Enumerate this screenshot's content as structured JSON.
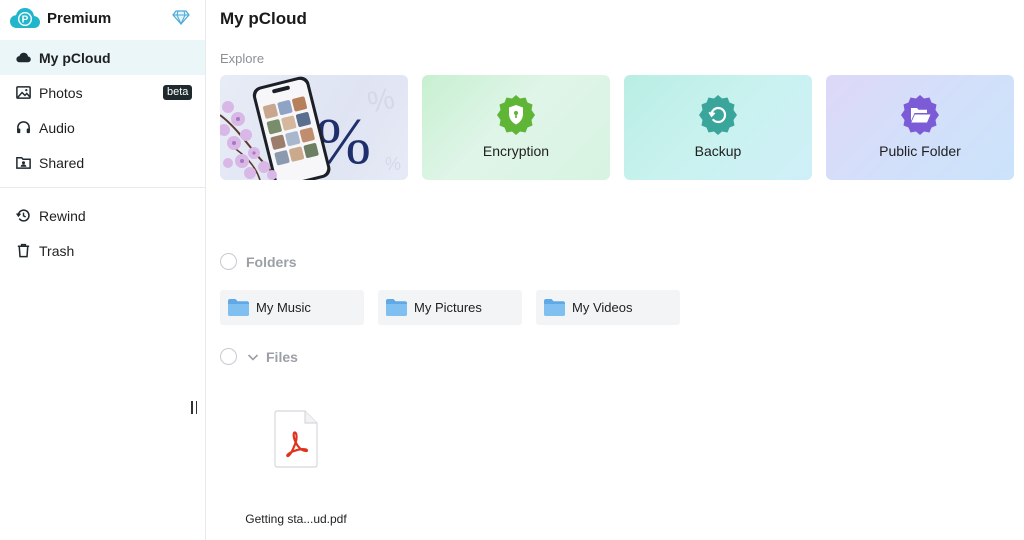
{
  "brand": {
    "name": "Premium",
    "logo_icon": "pcloud-logo-icon",
    "diamond_icon": "diamond-icon"
  },
  "sidebar": {
    "items": [
      {
        "label": "My pCloud",
        "icon": "cloud-icon",
        "active": true
      },
      {
        "label": "Photos",
        "icon": "image-icon",
        "badge": "beta"
      },
      {
        "label": "Audio",
        "icon": "headphones-icon"
      },
      {
        "label": "Shared",
        "icon": "shared-folder-icon"
      },
      {
        "label": "Rewind",
        "icon": "rewind-icon"
      },
      {
        "label": "Trash",
        "icon": "trash-icon"
      }
    ]
  },
  "main": {
    "title": "My pCloud",
    "explore_label": "Explore",
    "cards": [
      {
        "label": "",
        "kind": "promo",
        "promo_text": "%"
      },
      {
        "label": "Encryption",
        "icon": "shield-icon",
        "color": "#5fb536"
      },
      {
        "label": "Backup",
        "icon": "backup-icon",
        "color": "#3aa59a"
      },
      {
        "label": "Public Folder",
        "icon": "folder-open-icon",
        "color": "#7b5cd6"
      }
    ],
    "folders_title": "Folders",
    "folders": [
      {
        "label": "My Music"
      },
      {
        "label": "My Pictures"
      },
      {
        "label": "My Videos"
      }
    ],
    "files_title": "Files",
    "files": [
      {
        "name": "Getting sta...ud.pdf",
        "icon": "pdf-icon"
      }
    ]
  },
  "colors": {
    "accent": "#17bed0",
    "active_bg": "#eaf6f8",
    "pdf_red": "#e0331e",
    "folder_blue": "#6cb2e8"
  }
}
